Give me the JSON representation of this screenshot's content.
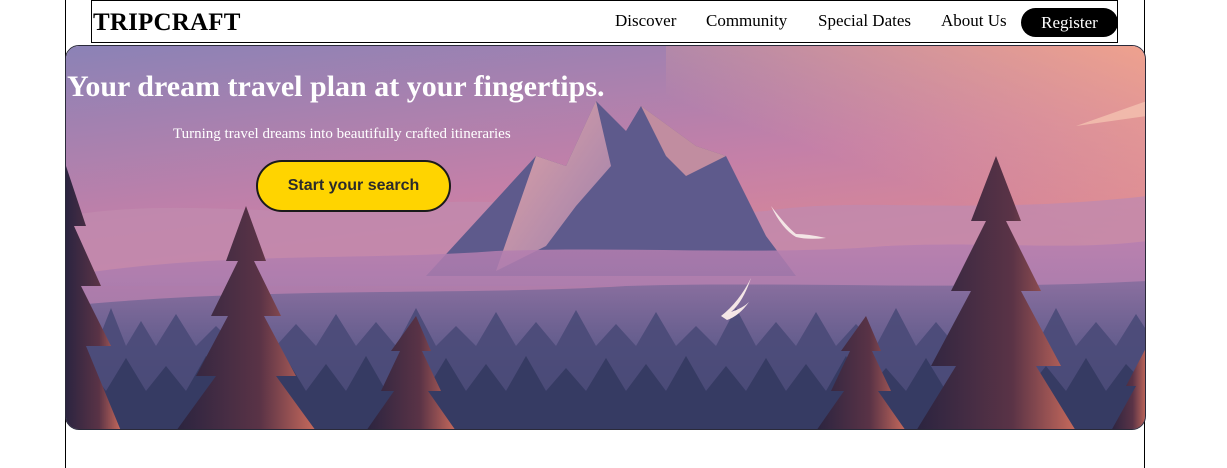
{
  "header": {
    "logo": "TRIPCRAFT",
    "nav": [
      {
        "label": "Discover"
      },
      {
        "label": "Community"
      },
      {
        "label": "Special Dates"
      },
      {
        "label": "About Us"
      }
    ],
    "register_label": "Register"
  },
  "hero": {
    "title": "Your dream travel plan at your fingertips.",
    "subtitle": "Turning travel dreams into beautifully crafted itineraries",
    "cta_label": "Start your search",
    "image": "mountain-forest-sunset-illustration"
  },
  "colors": {
    "cta_background": "#ffd400",
    "register_background": "#000000",
    "sky_top": "#8d7fb3",
    "sky_bottom": "#f08a80"
  }
}
